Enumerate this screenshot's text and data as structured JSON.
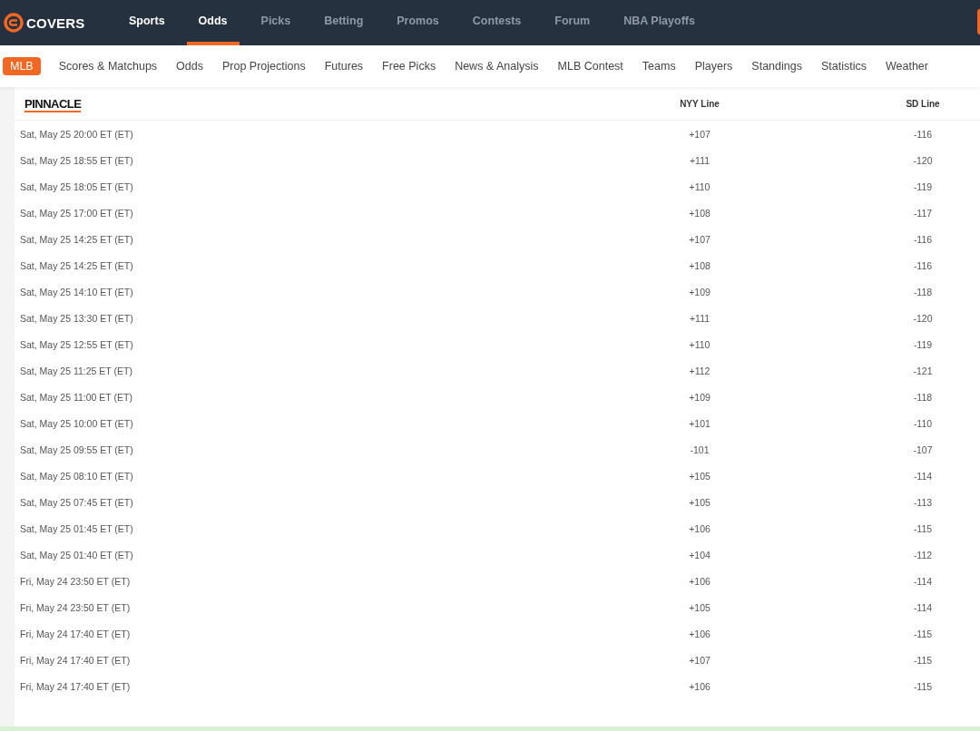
{
  "header": {
    "logo": "COVERS",
    "nav": [
      {
        "label": "Sports",
        "selected": false,
        "emphasis": true
      },
      {
        "label": "Odds",
        "selected": true,
        "emphasis": true
      },
      {
        "label": "Picks",
        "selected": false,
        "emphasis": false
      },
      {
        "label": "Betting",
        "selected": false,
        "emphasis": false
      },
      {
        "label": "Promos",
        "selected": false,
        "emphasis": false
      },
      {
        "label": "Contests",
        "selected": false,
        "emphasis": false
      },
      {
        "label": "Forum",
        "selected": false,
        "emphasis": false
      },
      {
        "label": "NBA Playoffs",
        "selected": false,
        "emphasis": false
      }
    ]
  },
  "subnav": [
    {
      "label": "MLB",
      "selected": true
    },
    {
      "label": "Scores & Matchups",
      "selected": false
    },
    {
      "label": "Odds",
      "selected": false
    },
    {
      "label": "Prop Projections",
      "selected": false
    },
    {
      "label": "Futures",
      "selected": false
    },
    {
      "label": "Free Picks",
      "selected": false
    },
    {
      "label": "News & Analysis",
      "selected": false
    },
    {
      "label": "MLB Contest",
      "selected": false
    },
    {
      "label": "Teams",
      "selected": false
    },
    {
      "label": "Players",
      "selected": false
    },
    {
      "label": "Standings",
      "selected": false
    },
    {
      "label": "Statistics",
      "selected": false
    },
    {
      "label": "Weather",
      "selected": false
    }
  ],
  "table": {
    "columns": [
      "PINNACLE",
      "NYY Line",
      "SD Line"
    ],
    "rows": [
      [
        "Sat, May 25 20:00 ET (ET)",
        "+107",
        "-116"
      ],
      [
        "Sat, May 25 18:55 ET (ET)",
        "+111",
        "-120"
      ],
      [
        "Sat, May 25 18:05 ET (ET)",
        "+110",
        "-119"
      ],
      [
        "Sat, May 25 17:00 ET (ET)",
        "+108",
        "-117"
      ],
      [
        "Sat, May 25 14:25 ET (ET)",
        "+107",
        "-116"
      ],
      [
        "Sat, May 25 14:25 ET (ET)",
        "+108",
        "-116"
      ],
      [
        "Sat, May 25 14:10 ET (ET)",
        "+109",
        "-118"
      ],
      [
        "Sat, May 25 13:30 ET (ET)",
        "+111",
        "-120"
      ],
      [
        "Sat, May 25 12:55 ET (ET)",
        "+110",
        "-119"
      ],
      [
        "Sat, May 25 11:25 ET (ET)",
        "+112",
        "-121"
      ],
      [
        "Sat, May 25 11:00 ET (ET)",
        "+109",
        "-118"
      ],
      [
        "Sat, May 25 10:00 ET (ET)",
        "+101",
        "-110"
      ],
      [
        "Sat, May 25 09:55 ET (ET)",
        "-101",
        "-107"
      ],
      [
        "Sat, May 25 08:10 ET (ET)",
        "+105",
        "-114"
      ],
      [
        "Sat, May 25 07:45 ET (ET)",
        "+105",
        "-113"
      ],
      [
        "Sat, May 25 01:45 ET (ET)",
        "+106",
        "-115"
      ],
      [
        "Sat, May 25 01:40 ET (ET)",
        "+104",
        "-112"
      ],
      [
        "Fri, May 24 23:50 ET (ET)",
        "+106",
        "-114"
      ],
      [
        "Fri, May 24 23:50 ET (ET)",
        "+105",
        "-114"
      ],
      [
        "Fri, May 24 17:40 ET (ET)",
        "+106",
        "-115"
      ],
      [
        "Fri, May 24 17:40 ET (ET)",
        "+107",
        "-115"
      ],
      [
        "Fri, May 24 17:40 ET (ET)",
        "+106",
        "-115"
      ]
    ]
  }
}
